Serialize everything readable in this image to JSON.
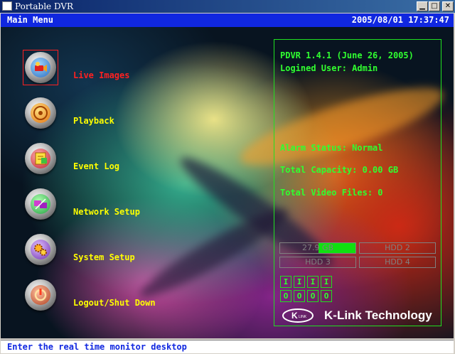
{
  "window": {
    "title": "Portable DVR"
  },
  "header": {
    "menu_title": "Main Menu",
    "datetime": "2005/08/01 17:37:47"
  },
  "menu": {
    "items": [
      {
        "label": "Live Images",
        "icon": "camera-icon",
        "selected": true
      },
      {
        "label": "Playback",
        "icon": "playback-icon",
        "selected": false
      },
      {
        "label": "Event Log",
        "icon": "event-log-icon",
        "selected": false
      },
      {
        "label": "Network Setup",
        "icon": "network-icon",
        "selected": false
      },
      {
        "label": "System Setup",
        "icon": "gears-icon",
        "selected": false
      },
      {
        "label": "Logout/Shut Down",
        "icon": "power-icon",
        "selected": false
      }
    ]
  },
  "info": {
    "version": "PDVR 1.4.1  (June 26, 2005)",
    "user": "Logined User: Admin",
    "alarm_status": "Alarm Status: Normal",
    "total_capacity": "Total Capacity: 0.00 GB",
    "total_video_files": "Total Video Files: 0"
  },
  "hdd": [
    {
      "label": "27.9 GB",
      "active": true,
      "fill_fraction": 0.5
    },
    {
      "label": "HDD 2",
      "active": false
    },
    {
      "label": "HDD 3",
      "active": false
    },
    {
      "label": "HDD 4",
      "active": false
    }
  ],
  "cameras": {
    "top_row": [
      "I",
      "I",
      "I",
      "I"
    ],
    "bottom_row": [
      "O",
      "O",
      "O",
      "O"
    ]
  },
  "brand": {
    "logo_text": "LINK",
    "name": "K-Link Technology"
  },
  "status": {
    "text": "Enter the real time monitor desktop"
  },
  "colors": {
    "menu_bar": "#1027e0",
    "label": "#ffff00",
    "selected_label": "#ff2020",
    "info_text": "#30ff30",
    "hdd_fill": "#10e010"
  }
}
